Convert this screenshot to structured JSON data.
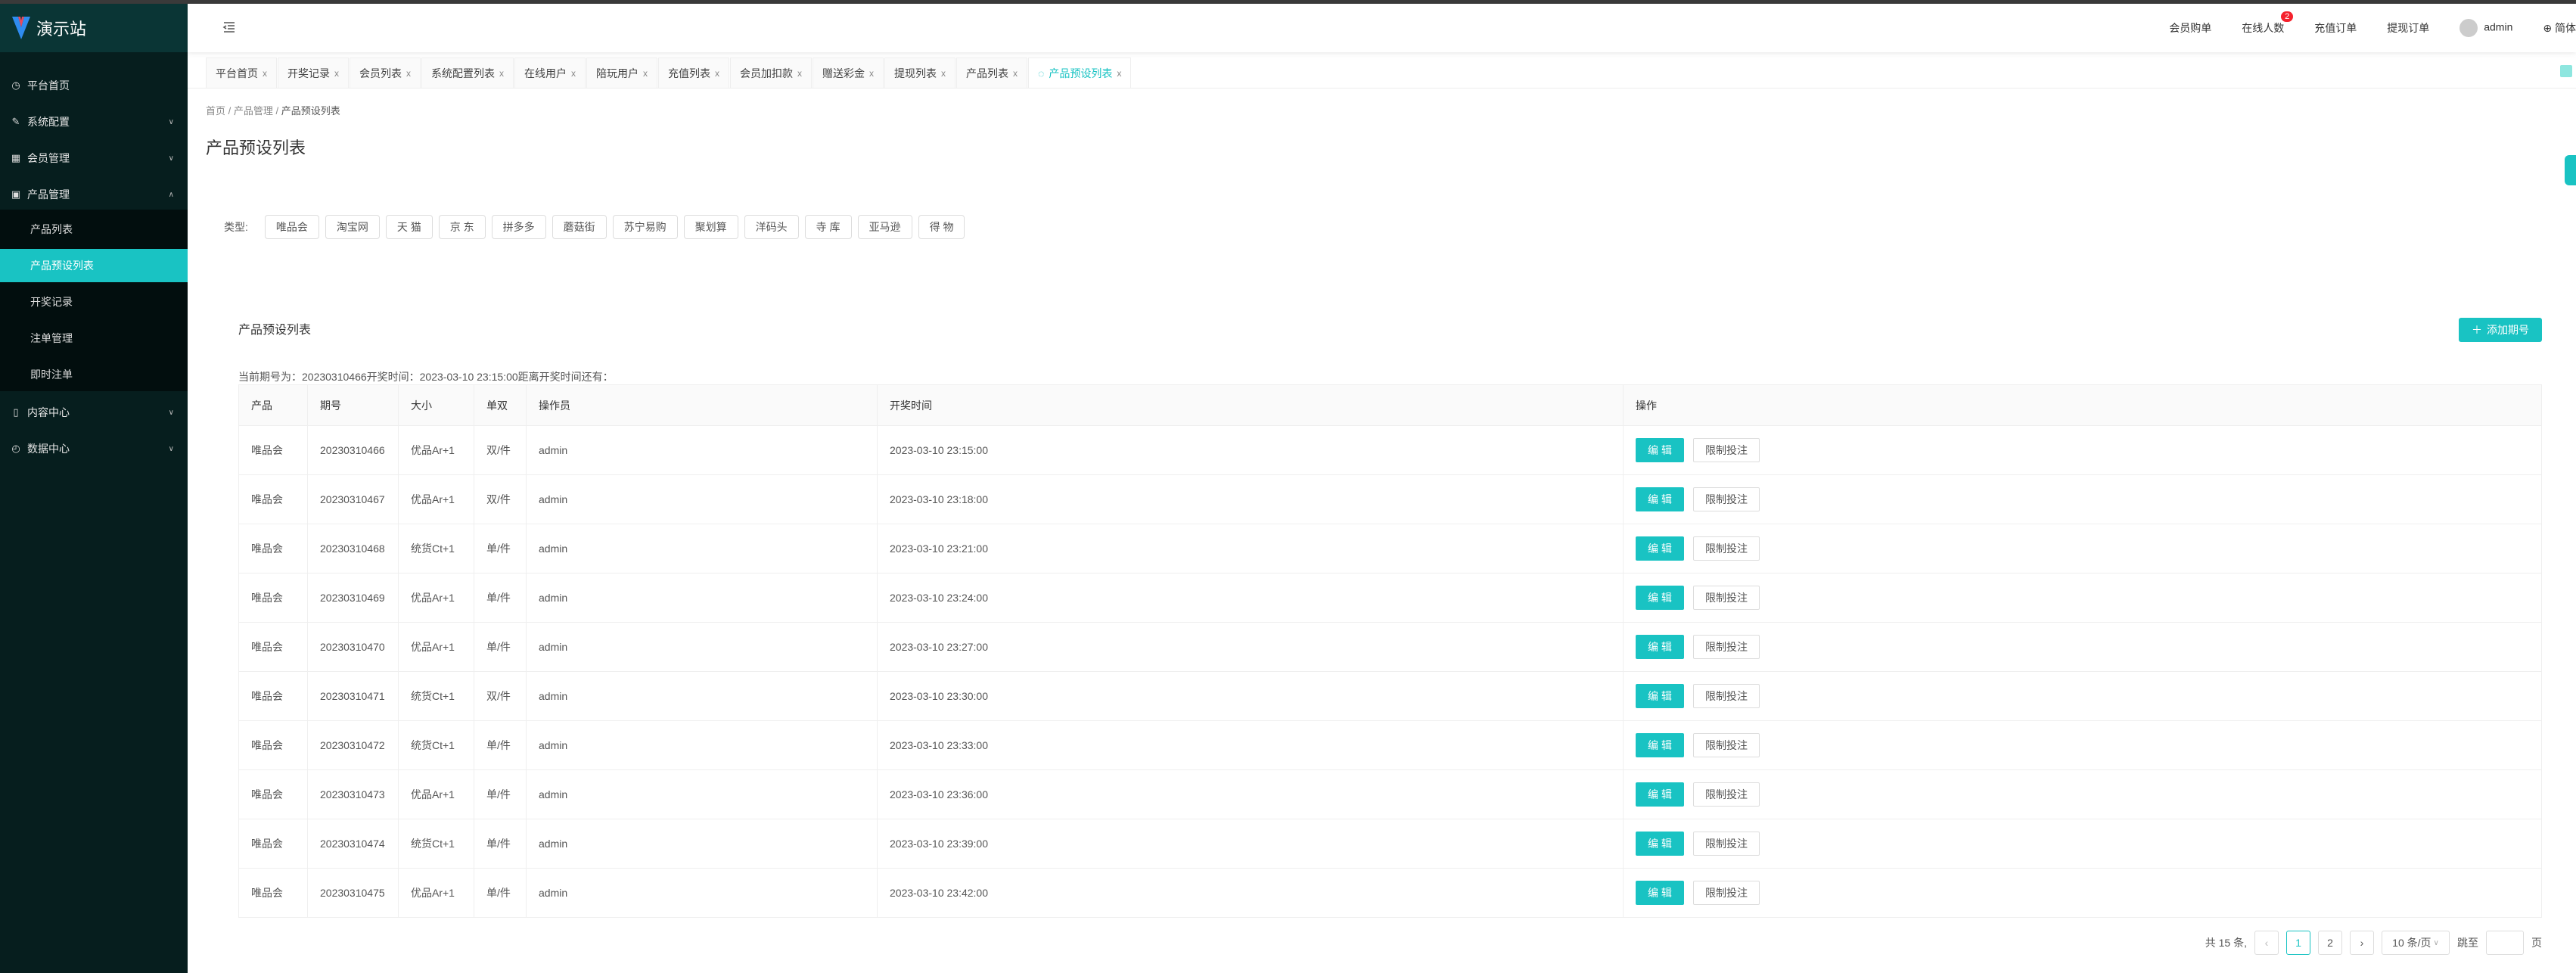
{
  "app": {
    "title": "演示站"
  },
  "colors": {
    "accent": "#19c3c3",
    "sidebar": "#061e1e",
    "badge": "#f5222d"
  },
  "sidebar": {
    "items": [
      {
        "label": "平台首页",
        "icon": "dashboard-icon"
      },
      {
        "label": "系统配置",
        "icon": "edit-icon"
      },
      {
        "label": "会员管理",
        "icon": "table-icon"
      },
      {
        "label": "产品管理",
        "icon": "grid-icon"
      },
      {
        "label": "内容中心",
        "icon": "document-icon"
      },
      {
        "label": "数据中心",
        "icon": "clock-icon"
      }
    ],
    "sub_items": [
      "产品列表",
      "产品预设列表",
      "开奖记录",
      "注单管理",
      "即时注单"
    ]
  },
  "header": {
    "links": [
      "会员购单",
      "在线人数",
      "充值订单",
      "提现订单"
    ],
    "online_badge": "2",
    "user": "admin",
    "language": "简体"
  },
  "tabs": [
    "平台首页",
    "开奖记录",
    "会员列表",
    "系统配置列表",
    "在线用户",
    "陪玩用户",
    "充值列表",
    "会员加扣款",
    "赠送彩金",
    "提现列表",
    "产品列表",
    "产品预设列表"
  ],
  "breadcrumb": [
    "首页",
    "产品管理",
    "产品预设列表"
  ],
  "page_title": "产品预设列表",
  "filter": {
    "label": "类型:",
    "types": [
      "唯品会",
      "淘宝网",
      "天 猫",
      "京 东",
      "拼多多",
      "蘑菇街",
      "苏宁易购",
      "聚划算",
      "洋码头",
      "寺 库",
      "亚马逊",
      "得 物"
    ]
  },
  "section": {
    "title": "产品预设列表",
    "add_label": "添加期号",
    "info": "当前期号为：20230310466开奖时间：2023-03-10 23:15:00距离开奖时间还有："
  },
  "table": {
    "columns": [
      "产品",
      "期号",
      "大小",
      "单双",
      "操作员",
      "开奖时间",
      "操作"
    ],
    "edit_label": "编 辑",
    "limit_label": "限制投注",
    "rows": [
      [
        "唯品会",
        "20230310466",
        "优品Ar+1",
        "双/件",
        "admin",
        "2023-03-10 23:15:00"
      ],
      [
        "唯品会",
        "20230310467",
        "优品Ar+1",
        "双/件",
        "admin",
        "2023-03-10 23:18:00"
      ],
      [
        "唯品会",
        "20230310468",
        "统货Ct+1",
        "单/件",
        "admin",
        "2023-03-10 23:21:00"
      ],
      [
        "唯品会",
        "20230310469",
        "优品Ar+1",
        "单/件",
        "admin",
        "2023-03-10 23:24:00"
      ],
      [
        "唯品会",
        "20230310470",
        "优品Ar+1",
        "单/件",
        "admin",
        "2023-03-10 23:27:00"
      ],
      [
        "唯品会",
        "20230310471",
        "统货Ct+1",
        "双/件",
        "admin",
        "2023-03-10 23:30:00"
      ],
      [
        "唯品会",
        "20230310472",
        "统货Ct+1",
        "单/件",
        "admin",
        "2023-03-10 23:33:00"
      ],
      [
        "唯品会",
        "20230310473",
        "优品Ar+1",
        "单/件",
        "admin",
        "2023-03-10 23:36:00"
      ],
      [
        "唯品会",
        "20230310474",
        "统货Ct+1",
        "单/件",
        "admin",
        "2023-03-10 23:39:00"
      ],
      [
        "唯品会",
        "20230310475",
        "优品Ar+1",
        "单/件",
        "admin",
        "2023-03-10 23:42:00"
      ]
    ]
  },
  "pagination": {
    "total": "共 15 条,",
    "pages": [
      "1",
      "2"
    ],
    "current": "1",
    "page_size": "10 条/页",
    "jump_label": "跳至",
    "page_suffix": "页"
  }
}
